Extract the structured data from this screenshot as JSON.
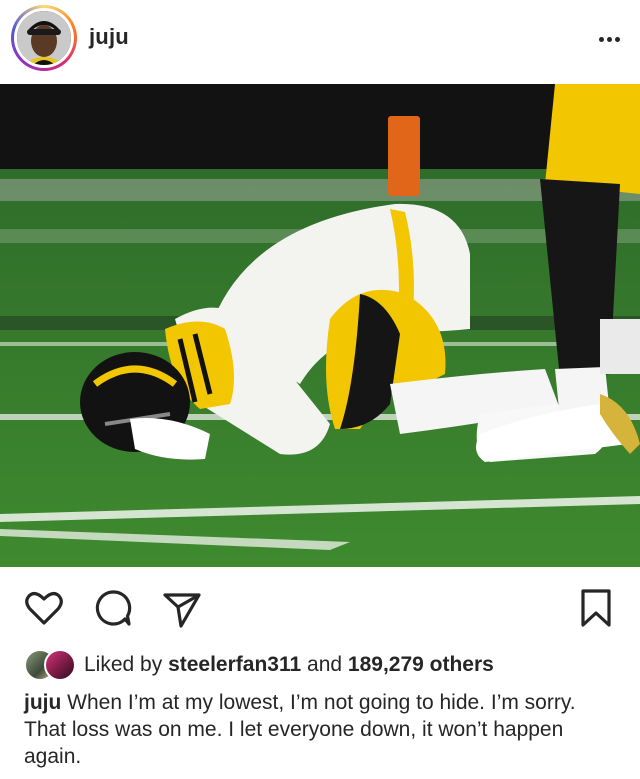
{
  "post": {
    "username": "juju",
    "more_icon": "more-horizontal-icon",
    "photo_icon": "post-photo"
  },
  "actions": {
    "like_icon": "heart-icon",
    "comment_icon": "comment-icon",
    "share_icon": "share-icon",
    "save_icon": "bookmark-icon"
  },
  "likes": {
    "prefix": "Liked by",
    "user": "steelerfan311",
    "middle": "and",
    "count": "189,279 others"
  },
  "caption": {
    "username": "juju",
    "text": "When I’m at my lowest, I’m not going to hide. I’m sorry. That loss was on me. I let everyone down, it won’t happen again."
  }
}
